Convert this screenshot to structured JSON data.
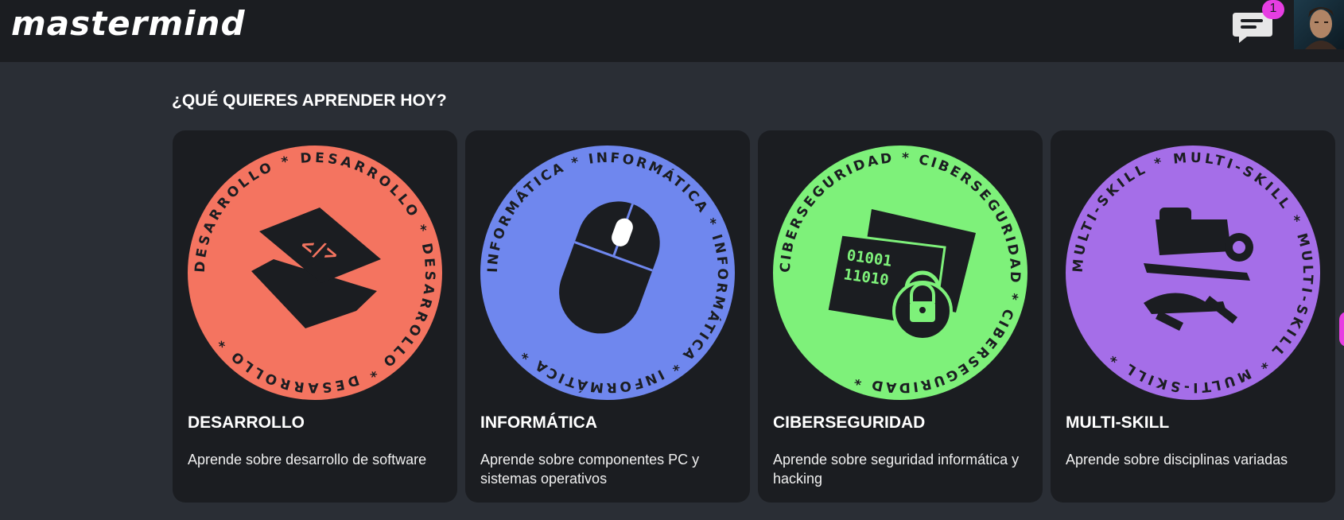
{
  "app": {
    "logo": "mastermind",
    "notification_count": "1"
  },
  "colors": {
    "background": "#2a2e35",
    "topbar": "#1b1d21",
    "card": "#1b1d21",
    "desarrollo": "#f47460",
    "informatica": "#6f87ee",
    "ciberseguridad": "#7ef17a",
    "multiskill": "#a56ee8",
    "badge": "#e63ee2"
  },
  "header": {
    "chat_icon": "chat-bubble-icon",
    "avatar": "user-avatar"
  },
  "main": {
    "title": "¿QUÉ QUIERES APRENDER HOY?",
    "cards": [
      {
        "title": "DESARROLLO",
        "description": "Aprende sobre desarrollo de software",
        "ring": "DESARROLLO * DESARROLLO * DESARROLLO * DESARROLLO * ",
        "icon": "code-layers-icon"
      },
      {
        "title": "INFORMÁTICA",
        "description": "Aprende sobre componentes PC y sistemas operativos",
        "ring": "INFORMÁTICA * INFORMÁTICA * INFORMÁTICA * INFORMÁTICA * ",
        "icon": "mouse-icon"
      },
      {
        "title": "CIBERSEGURIDAD",
        "description": "Aprende sobre seguridad informática y hacking",
        "ring": "CIBERSEGURIDAD * CIBERSEGURIDAD * CIBERSEGURIDAD * ",
        "icon": "card-lock-icon",
        "icon_text": [
          "01001",
          "11010"
        ]
      },
      {
        "title": "MULTI-SKILL",
        "description": "Aprende sobre disciplinas variadas",
        "ring": "MULTI-SKILL * MULTI-SKILL * MULTI-SKILL * MULTI-SKILL * ",
        "icon": "tools-icon"
      }
    ]
  }
}
